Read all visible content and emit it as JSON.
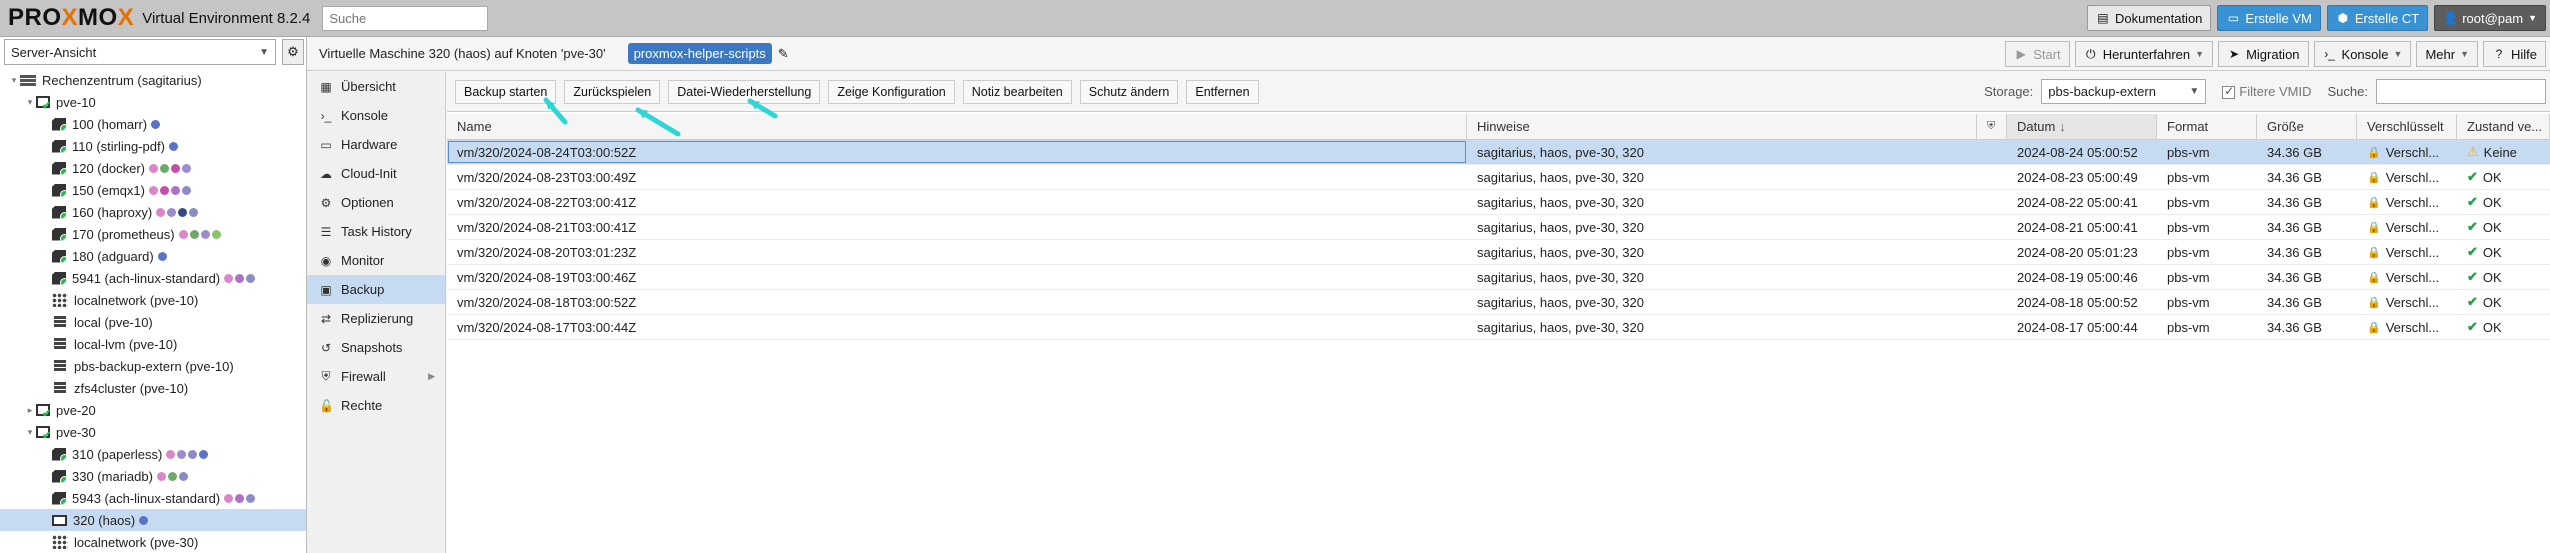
{
  "brand": {
    "logo_text_1": "PRO",
    "logo_x1": "X",
    "logo_text_2": "MO",
    "logo_x2": "X",
    "version": "Virtual Environment 8.2.4"
  },
  "search": {
    "placeholder": "Suche"
  },
  "top_buttons": [
    {
      "label": "Dokumentation",
      "icon": "book-icon"
    },
    {
      "label": "Erstelle VM",
      "icon": "monitor-icon"
    },
    {
      "label": "Erstelle CT",
      "icon": "cube-icon"
    },
    {
      "label": "root@pam",
      "icon": "user-icon"
    }
  ],
  "view_select": {
    "value": "Server-Ansicht"
  },
  "tree": [
    {
      "label": "Rechenzentrum (sagitarius)",
      "icon": "server-icon",
      "indent": 1
    },
    {
      "label": "pve-10",
      "icon": "node-icon",
      "indent": 2
    },
    {
      "label": "100 (homarr)",
      "icon": "vm-icon",
      "indent": 3,
      "tags": [
        "#5b73c7"
      ]
    },
    {
      "label": "110 (stirling-pdf)",
      "icon": "vm-icon",
      "indent": 3,
      "tags": [
        "#5b73c7"
      ]
    },
    {
      "label": "120 (docker)",
      "icon": "vm-icon",
      "indent": 3,
      "tags": [
        "#d987c8",
        "#6fa86b",
        "#c44ea8",
        "#9c8ccf"
      ]
    },
    {
      "label": "150 (emqx1)",
      "icon": "vm-icon",
      "indent": 3,
      "tags": [
        "#d987c8",
        "#c44ea8",
        "#b070c8",
        "#8c8cc4"
      ]
    },
    {
      "label": "160 (haproxy)",
      "icon": "vm-icon",
      "indent": 3,
      "tags": [
        "#d987c8",
        "#9c8ccf",
        "#334b80",
        "#8c8cc4"
      ]
    },
    {
      "label": "170 (prometheus)",
      "icon": "vm-icon",
      "indent": 3,
      "tags": [
        "#d987c8",
        "#6fa86b",
        "#9c8ccf",
        "#8cc46b"
      ]
    },
    {
      "label": "180 (adguard)",
      "icon": "vm-icon",
      "indent": 3,
      "tags": [
        "#5b73c7"
      ]
    },
    {
      "label": "5941 (ach-linux-standard)",
      "icon": "vm-icon",
      "indent": 3,
      "tags": [
        "#d987c8",
        "#b070c8",
        "#8c8cc4"
      ]
    },
    {
      "label": "localnetwork (pve-10)",
      "icon": "network-icon",
      "indent": 3,
      "tags": []
    },
    {
      "label": "local (pve-10)",
      "icon": "storage-icon",
      "indent": 3,
      "tags": []
    },
    {
      "label": "local-lvm (pve-10)",
      "icon": "storage-icon",
      "indent": 3,
      "tags": []
    },
    {
      "label": "pbs-backup-extern (pve-10)",
      "icon": "storage-icon",
      "indent": 3,
      "tags": []
    },
    {
      "label": "zfs4cluster (pve-10)",
      "icon": "storage-icon",
      "indent": 3,
      "tags": []
    },
    {
      "label": "pve-20",
      "icon": "node-icon",
      "indent": 2,
      "tags": []
    },
    {
      "label": "pve-30",
      "icon": "node-icon",
      "indent": 2,
      "tags": []
    },
    {
      "label": "310 (paperless)",
      "icon": "vm-icon",
      "indent": 3,
      "tags": [
        "#d987c8",
        "#9c8ccf",
        "#8c8cc4",
        "#5b73c7"
      ]
    },
    {
      "label": "330 (mariadb)",
      "icon": "vm-icon",
      "indent": 3,
      "tags": [
        "#d987c8",
        "#6fa86b",
        "#8c8cc4"
      ]
    },
    {
      "label": "5943 (ach-linux-standard)",
      "icon": "vm-icon",
      "indent": 3,
      "tags": [
        "#d987c8",
        "#b070c8",
        "#8c8cc4"
      ]
    },
    {
      "label": "320 (haos)",
      "icon": "monitor-icon",
      "indent": 3,
      "tags": [
        "#5b73c7"
      ],
      "selected": true
    },
    {
      "label": "localnetwork (pve-30)",
      "icon": "network-icon",
      "indent": 3,
      "tags": []
    }
  ],
  "header": {
    "title": "Virtuelle Maschine 320 (haos) auf Knoten 'pve-30'",
    "tag": "proxmox-helper-scripts"
  },
  "header_buttons": [
    {
      "label": "Start",
      "icon": "play-icon",
      "disabled": true
    },
    {
      "label": "Herunterfahren",
      "icon": "power-icon",
      "caret": true
    },
    {
      "label": "Migration",
      "icon": "send-icon"
    },
    {
      "label": "Konsole",
      "icon": "terminal-icon",
      "caret": true
    },
    {
      "label": "Mehr",
      "icon": "",
      "caret": true
    },
    {
      "label": "Hilfe",
      "icon": "help-icon"
    }
  ],
  "nav": [
    {
      "label": "Übersicht",
      "icon": "summary-icon"
    },
    {
      "label": "Konsole",
      "icon": "terminal-icon"
    },
    {
      "label": "Hardware",
      "icon": "desktop-icon"
    },
    {
      "label": "Cloud-Init",
      "icon": "cloud-icon"
    },
    {
      "label": "Optionen",
      "icon": "gear-icon"
    },
    {
      "label": "Task History",
      "icon": "list-icon"
    },
    {
      "label": "Monitor",
      "icon": "eye-icon"
    },
    {
      "label": "Backup",
      "icon": "floppy-icon",
      "selected": true
    },
    {
      "label": "Replizierung",
      "icon": "retweet-icon"
    },
    {
      "label": "Snapshots",
      "icon": "history-icon"
    },
    {
      "label": "Firewall",
      "icon": "shield-icon",
      "expand": true
    },
    {
      "label": "Rechte",
      "icon": "unlock-icon"
    }
  ],
  "toolbar": {
    "buttons": [
      "Backup starten",
      "Zurückspielen",
      "Datei-Wiederherstellung",
      "Zeige Konfiguration",
      "Notiz bearbeiten",
      "Schutz ändern",
      "Entfernen"
    ],
    "storage_label": "Storage:",
    "storage_value": "pbs-backup-extern",
    "filter_label": "Filtere VMID",
    "search_label": "Suche:"
  },
  "grid": {
    "columns": [
      "Name",
      "Hinweise",
      "",
      "Datum",
      "Format",
      "Größe",
      "Verschlüsselt",
      "Zustand ve..."
    ],
    "rows": [
      {
        "name": "vm/320/2024-08-24T03:00:52Z",
        "notes": "sagitarius, haos, pve-30, 320",
        "date": "2024-08-24 05:00:52",
        "format": "pbs-vm",
        "size": "34.36 GB",
        "encrypted": "Verschl...",
        "state": "Keine",
        "state_type": "warn",
        "selected": true
      },
      {
        "name": "vm/320/2024-08-23T03:00:49Z",
        "notes": "sagitarius, haos, pve-30, 320",
        "date": "2024-08-23 05:00:49",
        "format": "pbs-vm",
        "size": "34.36 GB",
        "encrypted": "Verschl...",
        "state": "OK",
        "state_type": "ok"
      },
      {
        "name": "vm/320/2024-08-22T03:00:41Z",
        "notes": "sagitarius, haos, pve-30, 320",
        "date": "2024-08-22 05:00:41",
        "format": "pbs-vm",
        "size": "34.36 GB",
        "encrypted": "Verschl...",
        "state": "OK",
        "state_type": "ok"
      },
      {
        "name": "vm/320/2024-08-21T03:00:41Z",
        "notes": "sagitarius, haos, pve-30, 320",
        "date": "2024-08-21 05:00:41",
        "format": "pbs-vm",
        "size": "34.36 GB",
        "encrypted": "Verschl...",
        "state": "OK",
        "state_type": "ok"
      },
      {
        "name": "vm/320/2024-08-20T03:01:23Z",
        "notes": "sagitarius, haos, pve-30, 320",
        "date": "2024-08-20 05:01:23",
        "format": "pbs-vm",
        "size": "34.36 GB",
        "encrypted": "Verschl...",
        "state": "OK",
        "state_type": "ok"
      },
      {
        "name": "vm/320/2024-08-19T03:00:46Z",
        "notes": "sagitarius, haos, pve-30, 320",
        "date": "2024-08-19 05:00:46",
        "format": "pbs-vm",
        "size": "34.36 GB",
        "encrypted": "Verschl...",
        "state": "OK",
        "state_type": "ok"
      },
      {
        "name": "vm/320/2024-08-18T03:00:52Z",
        "notes": "sagitarius, haos, pve-30, 320",
        "date": "2024-08-18 05:00:52",
        "format": "pbs-vm",
        "size": "34.36 GB",
        "encrypted": "Verschl...",
        "state": "OK",
        "state_type": "ok"
      },
      {
        "name": "vm/320/2024-08-17T03:00:44Z",
        "notes": "sagitarius, haos, pve-30, 320",
        "date": "2024-08-17 05:00:44",
        "format": "pbs-vm",
        "size": "34.36 GB",
        "encrypted": "Verschl...",
        "state": "OK",
        "state_type": "ok"
      }
    ]
  },
  "colors": {
    "accent": "#3892d4",
    "selection": "#c6dbf1",
    "ok": "#21a24b",
    "annotation_arrow": "#2ed6d6"
  }
}
